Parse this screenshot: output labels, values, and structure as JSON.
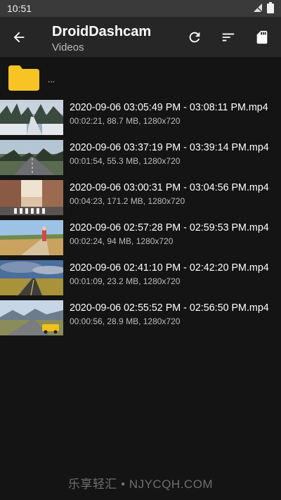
{
  "status": {
    "time": "10:51"
  },
  "appbar": {
    "title": "DroidDashcam",
    "subtitle": "Videos"
  },
  "icons": {
    "back": "arrow-back-icon",
    "refresh": "refresh-icon",
    "sort": "sort-icon",
    "storage": "sd-card-icon",
    "folder": "folder-icon"
  },
  "folder": {
    "label": "..."
  },
  "videos": [
    {
      "name": "2020-09-06 03:05:49 PM - 03:08:11 PM.mp4",
      "info": "00:02:21, 88.7 MB, 1280x720"
    },
    {
      "name": "2020-09-06 03:37:19 PM - 03:39:14 PM.mp4",
      "info": "00:01:54, 55.3 MB, 1280x720"
    },
    {
      "name": "2020-09-06 03:00:31 PM - 03:04:56 PM.mp4",
      "info": "00:04:23, 171.2 MB, 1280x720"
    },
    {
      "name": "2020-09-06 02:57:28 PM - 02:59:53 PM.mp4",
      "info": "00:02:24, 94 MB, 1280x720"
    },
    {
      "name": "2020-09-06 02:41:10 PM - 02:42:20 PM.mp4",
      "info": "00:01:09, 23.2 MB, 1280x720"
    },
    {
      "name": "2020-09-06 02:55:52 PM - 02:56:50 PM.mp4",
      "info": "00:00:56, 28.9 MB, 1280x720"
    }
  ],
  "watermark": "乐享轻汇 • NJYCQH.COM",
  "colors": {
    "statusbar": "#3a3a3a",
    "appbar": "#262626",
    "background": "#141414",
    "folder": "#f7c325"
  }
}
